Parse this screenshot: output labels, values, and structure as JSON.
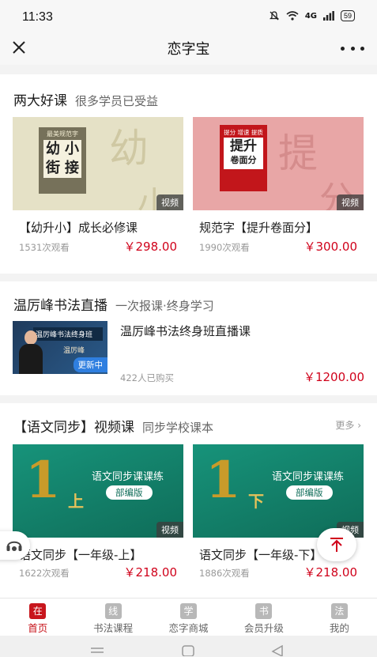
{
  "status": {
    "time": "11:33",
    "network": "4G",
    "battery": "59"
  },
  "header": {
    "title": "恋字宝"
  },
  "section1": {
    "title": "两大好课",
    "subtitle": "很多学员已受益",
    "cards": [
      {
        "title": "【幼升小】成长必修课",
        "views": "1531次观看",
        "price": "￥298.00",
        "badge": "视频",
        "thumb": {
          "big_chars": [
            "幼",
            "小",
            "街",
            "接"
          ],
          "header": "最美规范字",
          "watermark": "幼",
          "watermark2": "小"
        }
      },
      {
        "title": "规范字【提升卷面分】",
        "views": "1990次观看",
        "price": "￥300.00",
        "badge": "视频",
        "thumb": {
          "big_chars": "提升",
          "small_chars": "卷面分",
          "header": "提分 增速 提质",
          "watermark": "提",
          "watermark2": "分"
        }
      }
    ]
  },
  "section2": {
    "title": "温厉峰书法直播",
    "subtitle": "一次报课·终身学习",
    "item": {
      "title": "温厉峰书法终身班直播课",
      "buyers": "422人已购买",
      "price": "￥1200.00",
      "status_badge": "更新中",
      "banner": "温厉峰书法终身班",
      "signature": "温厉峰"
    }
  },
  "section3": {
    "title": "【语文同步】视频课",
    "subtitle": "同步学校课本",
    "more": "更多",
    "cards": [
      {
        "title": "语文同步【一年级-上】",
        "views": "1622次观看",
        "price": "￥218.00",
        "badge": "视频",
        "thumb": {
          "num": "1",
          "tag": "上",
          "line1": "语文同步课课练",
          "line2": "部编版"
        }
      },
      {
        "title": "语文同步【一年级-下】",
        "views": "1886次观看",
        "price": "￥218.00",
        "badge": "视频",
        "thumb": {
          "num": "1",
          "tag": "下",
          "line1": "语文同步课课练",
          "line2": "部编版"
        }
      }
    ]
  },
  "nav": [
    {
      "icon": "在",
      "label": "首页",
      "active": true
    },
    {
      "icon": "线",
      "label": "书法课程"
    },
    {
      "icon": "学",
      "label": "恋字商城"
    },
    {
      "icon": "书",
      "label": "会员升级"
    },
    {
      "icon": "法",
      "label": "我的"
    }
  ],
  "colors": {
    "accent": "#c8161d",
    "price": "#d0021b",
    "green": "#1a8e73",
    "gold": "#c89b2a"
  }
}
